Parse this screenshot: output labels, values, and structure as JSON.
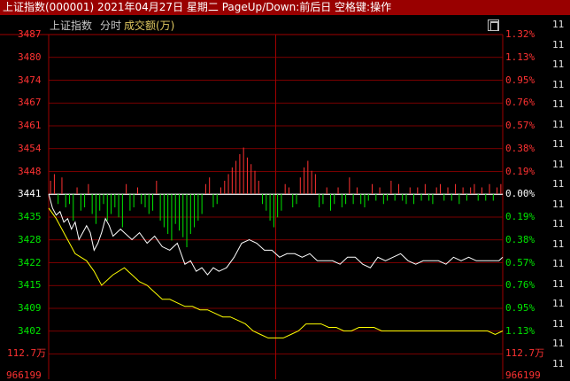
{
  "window": {
    "title": "上证指数(000001) 2021年04月27日 星期二 PageUp/Down:前后日 空格键:操作",
    "name": "上证指数",
    "period": "分时",
    "volume_label": "成交额(万)"
  },
  "price_axis": {
    "labels": [
      "3487",
      "3480",
      "3474",
      "3467",
      "3461",
      "3454",
      "3448",
      "3441",
      "3435",
      "3428",
      "3422",
      "3415",
      "3409",
      "3402"
    ],
    "ref_index": 7
  },
  "percent_axis": {
    "labels": [
      "1.32%",
      "1.13%",
      "0.95%",
      "0.76%",
      "0.57%",
      "0.38%",
      "0.19%",
      "0.00%",
      "0.19%",
      "0.38%",
      "0.57%",
      "0.76%",
      "0.95%",
      "1.13%"
    ]
  },
  "volume_axis": {
    "max_label": "112.7万",
    "bottom_label": "966199"
  },
  "right_panel_fragment": "11",
  "colors": {
    "up": "#ff3232",
    "down": "#00e600",
    "grid": "#a00000",
    "price": "#ffffff",
    "avg": "#ffff00"
  },
  "chart_data": {
    "type": "line",
    "x_unit": "minutes from open (0–240)",
    "prev_close": 3441,
    "ylim": [
      3398,
      3488
    ],
    "series": [
      {
        "name": "price",
        "x": [
          0,
          2,
          4,
          6,
          8,
          10,
          12,
          14,
          16,
          18,
          20,
          22,
          24,
          26,
          28,
          30,
          32,
          34,
          36,
          38,
          40,
          44,
          48,
          52,
          56,
          60,
          64,
          68,
          70,
          72,
          75,
          78,
          81,
          84,
          87,
          90,
          94,
          98,
          102,
          106,
          110,
          114,
          118,
          122,
          126,
          130,
          134,
          138,
          142,
          146,
          150,
          154,
          158,
          162,
          166,
          170,
          174,
          178,
          182,
          186,
          190,
          194,
          198,
          202,
          206,
          210,
          214,
          218,
          222,
          226,
          230,
          234,
          238,
          240
        ],
        "values": [
          3441,
          3437,
          3435,
          3436,
          3433,
          3434,
          3431,
          3433,
          3428,
          3430,
          3432,
          3430,
          3425,
          3427,
          3430,
          3434,
          3432,
          3429,
          3430,
          3431,
          3430,
          3428,
          3430,
          3427,
          3429,
          3426,
          3425,
          3427,
          3424,
          3421,
          3422,
          3419,
          3420,
          3418,
          3420,
          3419,
          3420,
          3423,
          3427,
          3428,
          3427,
          3425,
          3425,
          3423,
          3424,
          3424,
          3423,
          3424,
          3422,
          3422,
          3422,
          3421,
          3423,
          3423,
          3421,
          3420,
          3423,
          3422,
          3423,
          3424,
          3422,
          3421,
          3422,
          3422,
          3422,
          3421,
          3423,
          3422,
          3423,
          3422,
          3422,
          3422,
          3422,
          3423
        ]
      },
      {
        "name": "average",
        "x": [
          0,
          4,
          8,
          14,
          20,
          24,
          28,
          34,
          40,
          44,
          48,
          52,
          56,
          60,
          64,
          68,
          72,
          76,
          80,
          84,
          88,
          92,
          96,
          100,
          104,
          108,
          112,
          116,
          120,
          124,
          128,
          132,
          136,
          140,
          144,
          148,
          152,
          156,
          160,
          164,
          168,
          172,
          176,
          180,
          184,
          188,
          192,
          196,
          200,
          204,
          208,
          212,
          216,
          220,
          224,
          228,
          232,
          236,
          240
        ],
        "values": [
          3437,
          3434,
          3430,
          3424,
          3422,
          3419,
          3415,
          3418,
          3420,
          3418,
          3416,
          3415,
          3413,
          3411,
          3411,
          3410,
          3409,
          3409,
          3408,
          3408,
          3407,
          3406,
          3406,
          3405,
          3404,
          3402,
          3401,
          3400,
          3400,
          3400,
          3401,
          3402,
          3404,
          3404,
          3404,
          3403,
          3403,
          3402,
          3402,
          3403,
          3403,
          3403,
          3402,
          3402,
          3402,
          3402,
          3402,
          3402,
          3402,
          3402,
          3402,
          3402,
          3402,
          3402,
          3402,
          3402,
          3402,
          3401,
          3402
        ]
      }
    ],
    "volume": {
      "unit": "万",
      "max": 1127000,
      "per_bar_note": "sign indicates up (+) / down (-) tick",
      "x": [
        1,
        3,
        5,
        7,
        9,
        11,
        13,
        15,
        17,
        19,
        21,
        23,
        25,
        27,
        29,
        31,
        33,
        35,
        37,
        39,
        41,
        43,
        45,
        47,
        49,
        51,
        53,
        55,
        57,
        59,
        61,
        63,
        65,
        67,
        69,
        71,
        73,
        75,
        77,
        79,
        81,
        83,
        85,
        87,
        89,
        91,
        93,
        95,
        97,
        99,
        101,
        103,
        105,
        107,
        109,
        111,
        113,
        115,
        117,
        119,
        121,
        123,
        125,
        127,
        129,
        131,
        133,
        135,
        137,
        139,
        141,
        143,
        145,
        147,
        149,
        151,
        153,
        155,
        157,
        159,
        161,
        163,
        165,
        167,
        169,
        171,
        173,
        175,
        177,
        179,
        181,
        183,
        185,
        187,
        189,
        191,
        193,
        195,
        197,
        199,
        201,
        203,
        205,
        207,
        209,
        211,
        213,
        215,
        217,
        219,
        221,
        223,
        225,
        227,
        229,
        231,
        233,
        235,
        237,
        239
      ],
      "values": [
        4,
        6,
        -3,
        5,
        -4,
        -3,
        -8,
        2,
        -5,
        -4,
        3,
        -6,
        -9,
        -5,
        -3,
        -8,
        -6,
        -4,
        -7,
        -10,
        3,
        -5,
        -4,
        2,
        -3,
        -4,
        -6,
        -5,
        4,
        -8,
        -10,
        -12,
        -14,
        -9,
        -11,
        -13,
        -16,
        -12,
        -10,
        -8,
        -6,
        3,
        5,
        -4,
        -3,
        2,
        4,
        6,
        8,
        10,
        12,
        14,
        11,
        9,
        7,
        4,
        -3,
        -5,
        -8,
        -10,
        -7,
        -5,
        3,
        2,
        -4,
        -3,
        5,
        8,
        10,
        7,
        6,
        -4,
        -3,
        2,
        -5,
        -3,
        2,
        -4,
        -3,
        5,
        -3,
        2,
        -3,
        -4,
        -2,
        3,
        -2,
        2,
        -3,
        -2,
        4,
        -2,
        3,
        -2,
        -3,
        2,
        -3,
        2,
        -2,
        3,
        -2,
        -3,
        2,
        3,
        -2,
        2,
        -2,
        3,
        -3,
        2,
        -2,
        2,
        3,
        -2,
        2,
        -2,
        3,
        -2,
        2,
        3
      ]
    }
  }
}
